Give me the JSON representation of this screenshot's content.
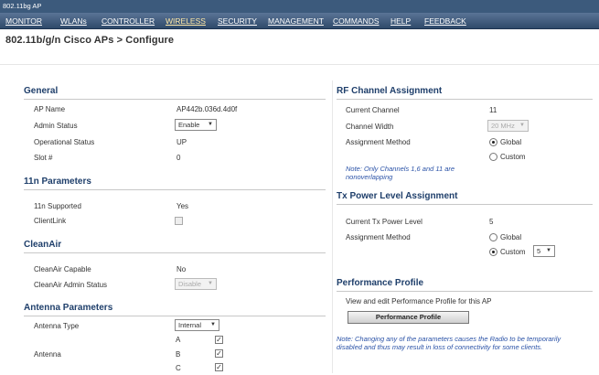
{
  "window": {
    "title": "802.11bg AP"
  },
  "menu": {
    "items": [
      "MONITOR",
      "WLANs",
      "CONTROLLER",
      "WIRELESS",
      "SECURITY",
      "MANAGEMENT",
      "COMMANDS",
      "HELP",
      "FEEDBACK"
    ],
    "active": "WIRELESS"
  },
  "page": {
    "title": "802.11b/g/n Cisco APs > Configure"
  },
  "general": {
    "title": "General",
    "ap_name_label": "AP Name",
    "ap_name_value": "AP442b.036d.4d0f",
    "admin_status_label": "Admin Status",
    "admin_status_value": "Enable",
    "operational_status_label": "Operational Status",
    "operational_status_value": "UP",
    "slot_label": "Slot #",
    "slot_value": "0"
  },
  "n11": {
    "title": "11n Parameters",
    "supported_label": "11n Supported",
    "supported_value": "Yes",
    "clientlink_label": "ClientLink",
    "clientlink_checked": false
  },
  "cleanair": {
    "title": "CleanAir",
    "capable_label": "CleanAir Capable",
    "capable_value": "No",
    "admin_status_label": "CleanAir Admin Status",
    "admin_status_value": "Disable"
  },
  "antenna": {
    "title": "Antenna Parameters",
    "type_label": "Antenna Type",
    "type_value": "Internal",
    "antenna_label": "Antenna",
    "antennas": [
      {
        "name": "A",
        "checked": true
      },
      {
        "name": "B",
        "checked": true
      },
      {
        "name": "C",
        "checked": true
      }
    ]
  },
  "rf": {
    "title": "RF Channel Assignment",
    "current_channel_label": "Current Channel",
    "current_channel_value": "11",
    "channel_width_label": "Channel Width",
    "channel_width_value": "20 MHz",
    "method_label": "Assignment Method",
    "global_label": "Global",
    "custom_label": "Custom",
    "selected": "Global",
    "note": "Note: Only Channels 1,6 and 11 are nonoverlapping"
  },
  "tx": {
    "title": "Tx Power Level Assignment",
    "current_label": "Current Tx Power Level",
    "current_value": "5",
    "method_label": "Assignment Method",
    "global_label": "Global",
    "custom_label": "Custom",
    "selected": "Custom",
    "custom_value": "5"
  },
  "perf": {
    "title": "Performance Profile",
    "text": "View and edit Performance Profile for this AP",
    "button": "Performance Profile"
  },
  "footer_note": "Note: Changing any of the parameters causes the Radio to be temporarily disabled and thus may result in loss of connectivity for some clients."
}
